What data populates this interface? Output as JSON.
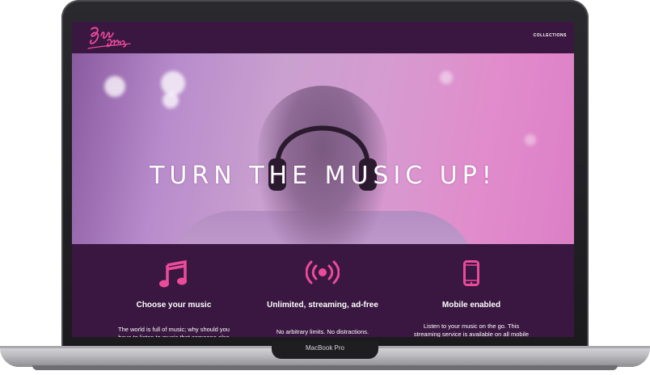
{
  "site": {
    "logo_text": "BVE JAMS",
    "nav": {
      "collections": "COLLECTIONS"
    }
  },
  "hero": {
    "title": "TURN THE MUSIC UP!"
  },
  "features": [
    {
      "icon": "music-note-icon",
      "title": "Choose your music",
      "text": "The world is full of music; why should you have to listen to music that someone else chose?"
    },
    {
      "icon": "broadcast-icon",
      "title": "Unlimited, streaming, ad-free",
      "text": "No arbitrary limits. No distractions."
    },
    {
      "icon": "mobile-phone-icon",
      "title": "Mobile enabled",
      "text": "Listen to your music on the go. This streaming service is available on all mobile platforms."
    }
  ],
  "device": {
    "label": "MacBook Pro"
  },
  "colors": {
    "brand_pink": "#ec4b9c",
    "background_purple": "#3a1740"
  }
}
